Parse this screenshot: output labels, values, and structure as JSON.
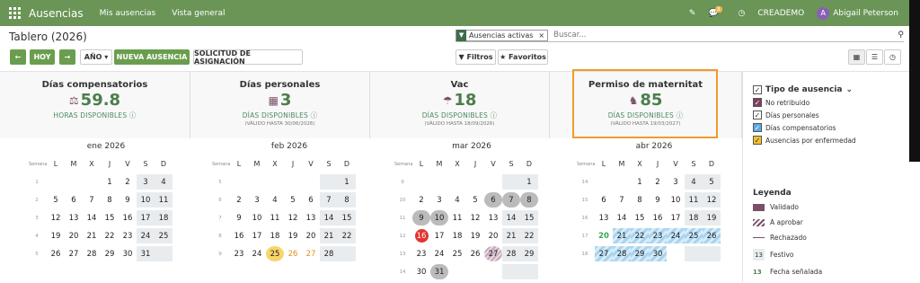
{
  "topbar": {
    "app": "Ausencias",
    "menu1": "Mis ausencias",
    "menu2": "Vista general",
    "badge": "3",
    "company": "CREADEMO",
    "user": "Abigail Peterson",
    "user_initial": "A"
  },
  "page": {
    "title": "Tablero (2026)"
  },
  "search": {
    "facet": "Ausencias activas",
    "placeholder": "Buscar..."
  },
  "toolbar": {
    "today": "HOY",
    "year": "AÑO",
    "new": "NUEVA AUSENCIA",
    "request": "SOLICITUD DE ASIGNACIÓN",
    "filters": "Filtros",
    "favorites": "Favoritos"
  },
  "cards": [
    {
      "title": "Días compensatorios",
      "value": "59.8",
      "label": "HORAS DISPONIBLES",
      "sub": ""
    },
    {
      "title": "Días personales",
      "value": "3",
      "label": "DÍAS DISPONIBLES",
      "sub": "(VÁLIDO HASTA 30/06/2026)"
    },
    {
      "title": "Vac",
      "value": "18",
      "label": "DÍAS DISPONIBLES",
      "sub": "(VÁLIDO HASTA 18/09/2026)"
    },
    {
      "title": "Permiso de maternitat",
      "value": "85",
      "label": "DÍAS DISPONIBLES",
      "sub": "(VÁLIDO HASTA 19/03/2027)"
    }
  ],
  "calendar": {
    "week_label": "Semana",
    "days": [
      "L",
      "M",
      "X",
      "J",
      "V",
      "S",
      "D"
    ],
    "months": [
      {
        "name": "ene 2026",
        "weeks": [
          [
            "1",
            "",
            "",
            "",
            "1",
            "2",
            "3",
            "4"
          ],
          [
            "2",
            "5",
            "6",
            "7",
            "8",
            "9",
            "10",
            "11"
          ],
          [
            "3",
            "12",
            "13",
            "14",
            "15",
            "16",
            "17",
            "18"
          ],
          [
            "4",
            "19",
            "20",
            "21",
            "22",
            "23",
            "24",
            "25"
          ],
          [
            "5",
            "26",
            "27",
            "28",
            "29",
            "30",
            "31",
            ""
          ]
        ]
      },
      {
        "name": "feb 2026",
        "weeks": [
          [
            "5",
            "",
            "",
            "",
            "",
            "",
            "",
            "1"
          ],
          [
            "6",
            "2",
            "3",
            "4",
            "5",
            "6",
            "7",
            "8"
          ],
          [
            "7",
            "9",
            "10",
            "11",
            "12",
            "13",
            "14",
            "15"
          ],
          [
            "8",
            "16",
            "17",
            "18",
            "19",
            "20",
            "21",
            "22"
          ],
          [
            "9",
            "23",
            "24",
            "25",
            "26",
            "27",
            "28",
            ""
          ]
        ]
      },
      {
        "name": "mar 2026",
        "weeks": [
          [
            "9",
            "",
            "",
            "",
            "",
            "",
            "",
            "1"
          ],
          [
            "10",
            "2",
            "3",
            "4",
            "5",
            "6",
            "7",
            "8"
          ],
          [
            "11",
            "9",
            "10",
            "11",
            "12",
            "13",
            "14",
            "15"
          ],
          [
            "12",
            "16",
            "17",
            "18",
            "19",
            "20",
            "21",
            "22"
          ],
          [
            "13",
            "23",
            "24",
            "25",
            "26",
            "27",
            "28",
            "29"
          ],
          [
            "14",
            "30",
            "31",
            "",
            "",
            "",
            "",
            ""
          ]
        ]
      },
      {
        "name": "abr 2026",
        "weeks": [
          [
            "14",
            "",
            "",
            "1",
            "2",
            "3",
            "4",
            "5"
          ],
          [
            "15",
            "6",
            "7",
            "8",
            "9",
            "10",
            "11",
            "12"
          ],
          [
            "16",
            "13",
            "14",
            "15",
            "16",
            "17",
            "18",
            "19"
          ],
          [
            "17",
            "20",
            "21",
            "22",
            "23",
            "24",
            "25",
            "26"
          ],
          [
            "18",
            "27",
            "28",
            "29",
            "30",
            "",
            "",
            ""
          ]
        ]
      }
    ]
  },
  "sidebar": {
    "title": "Tipo de ausencia",
    "types": [
      "No retribuido",
      "Días personales",
      "Días compensatorios",
      "Ausencias por enfermedad"
    ],
    "type_colors": [
      "#7b3f5e",
      "#ffffff",
      "#5aa9e6",
      "#f2c12e"
    ]
  },
  "legend": {
    "title": "Leyenda",
    "items": [
      "Validado",
      "A aprobar",
      "Rechazado",
      "Festivo",
      "Fecha señalada"
    ],
    "holiday_sample": "13",
    "signal_sample": "13"
  }
}
